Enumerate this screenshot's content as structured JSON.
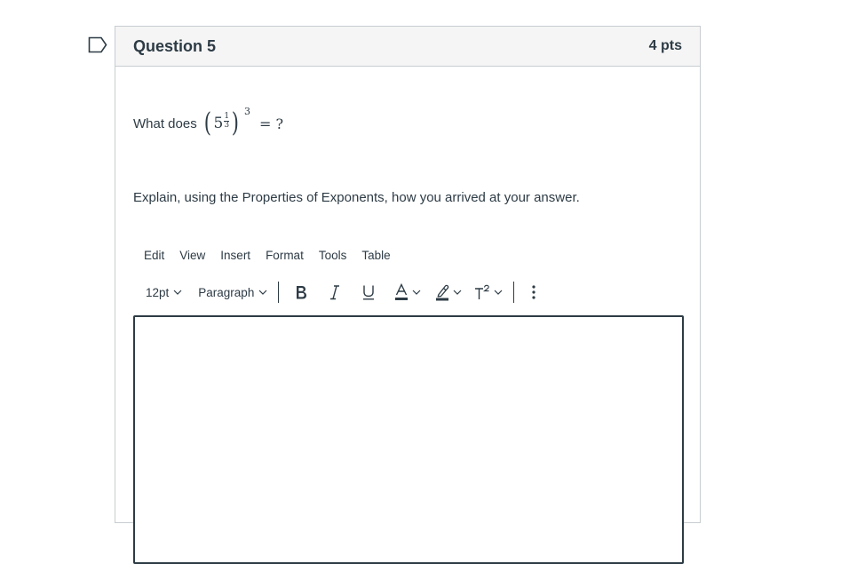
{
  "question": {
    "title": "Question 5",
    "points": "4 pts",
    "prompt_prefix": "What does",
    "math": {
      "base": "5",
      "inner_exp_numerator": "1",
      "inner_exp_denominator": "3",
      "outer_exp": "3",
      "suffix": "= ?"
    },
    "explanation": "Explain, using the Properties of Exponents, how you arrived at your answer."
  },
  "editor": {
    "menu": [
      "Edit",
      "View",
      "Insert",
      "Format",
      "Tools",
      "Table"
    ],
    "font_size": "12pt",
    "block_format": "Paragraph",
    "answer_text": ""
  },
  "colors": {
    "text": "#2d3b45",
    "header_bg": "#f5f5f5",
    "border": "#c7cdd1",
    "text_color_swatch": "#2d3b45"
  },
  "icons": {
    "flag": "bookmark-flag-icon",
    "bold": "bold-icon",
    "italic": "italic-icon",
    "underline": "underline-icon",
    "text_color": "text-color-icon",
    "highlight": "highlighter-icon",
    "superscript": "superscript-icon",
    "more": "more-vertical-icon"
  }
}
